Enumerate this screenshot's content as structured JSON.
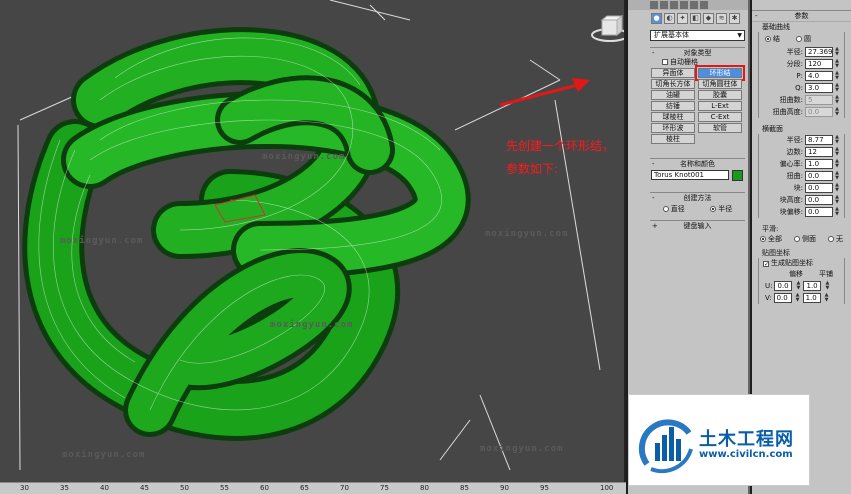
{
  "viewport": {
    "watermarks": [
      "moxingyun.com",
      "moxingyun.com",
      "moxingyun.com",
      "moxingyun.com",
      "moxingyun.com",
      "moxingyun.com"
    ],
    "annotation": "先创建一个环形结，参数如下:",
    "ruler_ticks": [
      "30",
      "35",
      "40",
      "45",
      "50",
      "55",
      "60",
      "65",
      "70",
      "75",
      "80",
      "85",
      "90",
      "95",
      "100"
    ],
    "object_color": "#18a018"
  },
  "command_panel": {
    "dropdown": "扩展基本体",
    "object_type": {
      "header": "对象类型",
      "auto_grid": "自动栅格",
      "buttons": [
        "异面体",
        "环形结",
        "切角长方体",
        "切角圆柱体",
        "油罐",
        "胶囊",
        "纺锤",
        "L-Ext",
        "球棱柱",
        "C-Ext",
        "环形波",
        "软管",
        "棱柱"
      ],
      "selected": "环形结"
    },
    "name_color": {
      "header": "名称和颜色",
      "name": "Torus Knot001",
      "color": "#1a9a1a"
    },
    "creation_method": {
      "header": "创建方法",
      "options": [
        "直径",
        "半径"
      ],
      "selected": "半径"
    },
    "keyboard_entry": {
      "header": "键盘输入"
    }
  },
  "parameters": {
    "header": "参数",
    "base_curve": {
      "title": "基础曲线",
      "options": [
        "结",
        "圆"
      ],
      "selected": "结",
      "radius_label": "半径:",
      "radius": "27.369",
      "segments_label": "分段:",
      "segments": "120",
      "p_label": "P:",
      "p": "4.0",
      "q_label": "Q:",
      "q": "3.0",
      "warp_count_label": "扭曲数:",
      "warp_count": "5",
      "warp_height_label": "扭曲高度:",
      "warp_height": "0.0"
    },
    "cross_section": {
      "title": "横截面",
      "radius_label": "半径:",
      "radius": "8.77",
      "sides_label": "边数:",
      "sides": "12",
      "eccentricity_label": "偏心率:",
      "eccentricity": "1.0",
      "twist_label": "扭曲:",
      "twist": "0.0",
      "lumps_label": "块:",
      "lumps": "0.0",
      "lump_height_label": "块高度:",
      "lump_height": "0.0",
      "lump_offset_label": "块偏移:",
      "lump_offset": "0.0"
    },
    "smooth": {
      "title": "平滑:",
      "options": [
        "全部",
        "侧面",
        "无"
      ],
      "selected": "全部"
    },
    "mapping": {
      "title": "贴图坐标",
      "generate_label": "生成贴图坐标",
      "offset_label": "偏移",
      "tiling_label": "平铺",
      "u_label": "U:",
      "u_offset": "0.0",
      "u_tiling": "1.0",
      "v_label": "V:",
      "v_offset": "0.0",
      "v_tiling": "1.0"
    }
  },
  "logo": {
    "title": "土木工程网",
    "url": "www.civilcn.com"
  }
}
